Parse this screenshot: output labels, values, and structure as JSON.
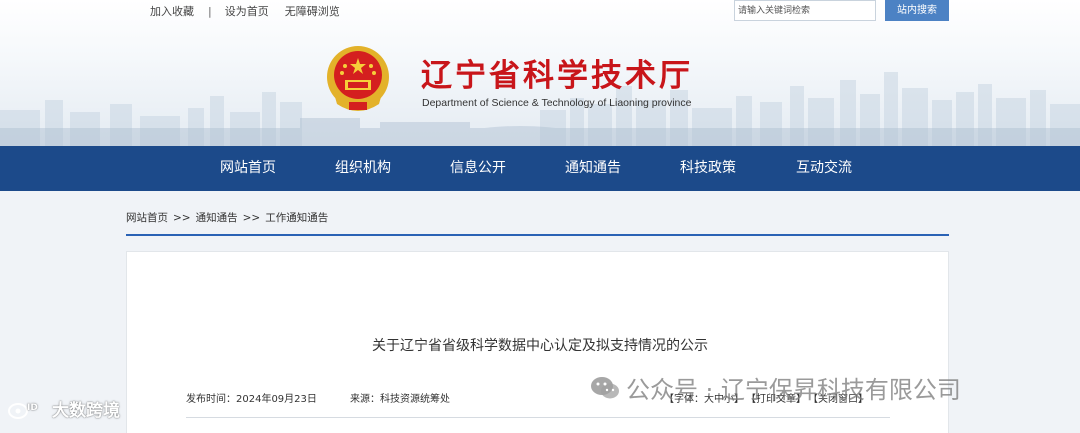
{
  "topbar": {
    "favorite_label": "加入收藏",
    "separator": "|",
    "homepage_label": "设为首页",
    "accessible_label": "无障碍浏览",
    "search_placeholder": "请输入关键词检索",
    "search_button": "站内搜索"
  },
  "header": {
    "title": "辽宁省科学技术厅",
    "subtitle": "Department of Science & Technology of Liaoning province",
    "emblem_icon": "national-emblem-icon"
  },
  "nav": {
    "items": [
      {
        "label": "网站首页"
      },
      {
        "label": "组织机构"
      },
      {
        "label": "信息公开"
      },
      {
        "label": "通知通告"
      },
      {
        "label": "科技政策"
      },
      {
        "label": "互动交流"
      }
    ]
  },
  "breadcrumb": {
    "items": [
      "网站首页",
      "通知通告",
      "工作通知通告"
    ],
    "separator": ">>"
  },
  "article": {
    "title": "关于辽宁省省级科学数据中心认定及拟支持情况的公示",
    "publish_label": "发布时间：2024年09月23日",
    "source_label": "来源：科技资源统筹处",
    "font_tool": "【字体：大中小】",
    "print_tool": "【打印文章】",
    "close_tool": "【关闭窗口】"
  },
  "watermarks": {
    "left_text": "大数跨境",
    "right_text": "公众号 · 辽宁保昇科技有限公司"
  },
  "colors": {
    "nav_bg": "#1c4a8a",
    "title_red": "#c8151a",
    "accent_blue": "#2a62b5",
    "search_button_bg": "#4c82c4"
  }
}
